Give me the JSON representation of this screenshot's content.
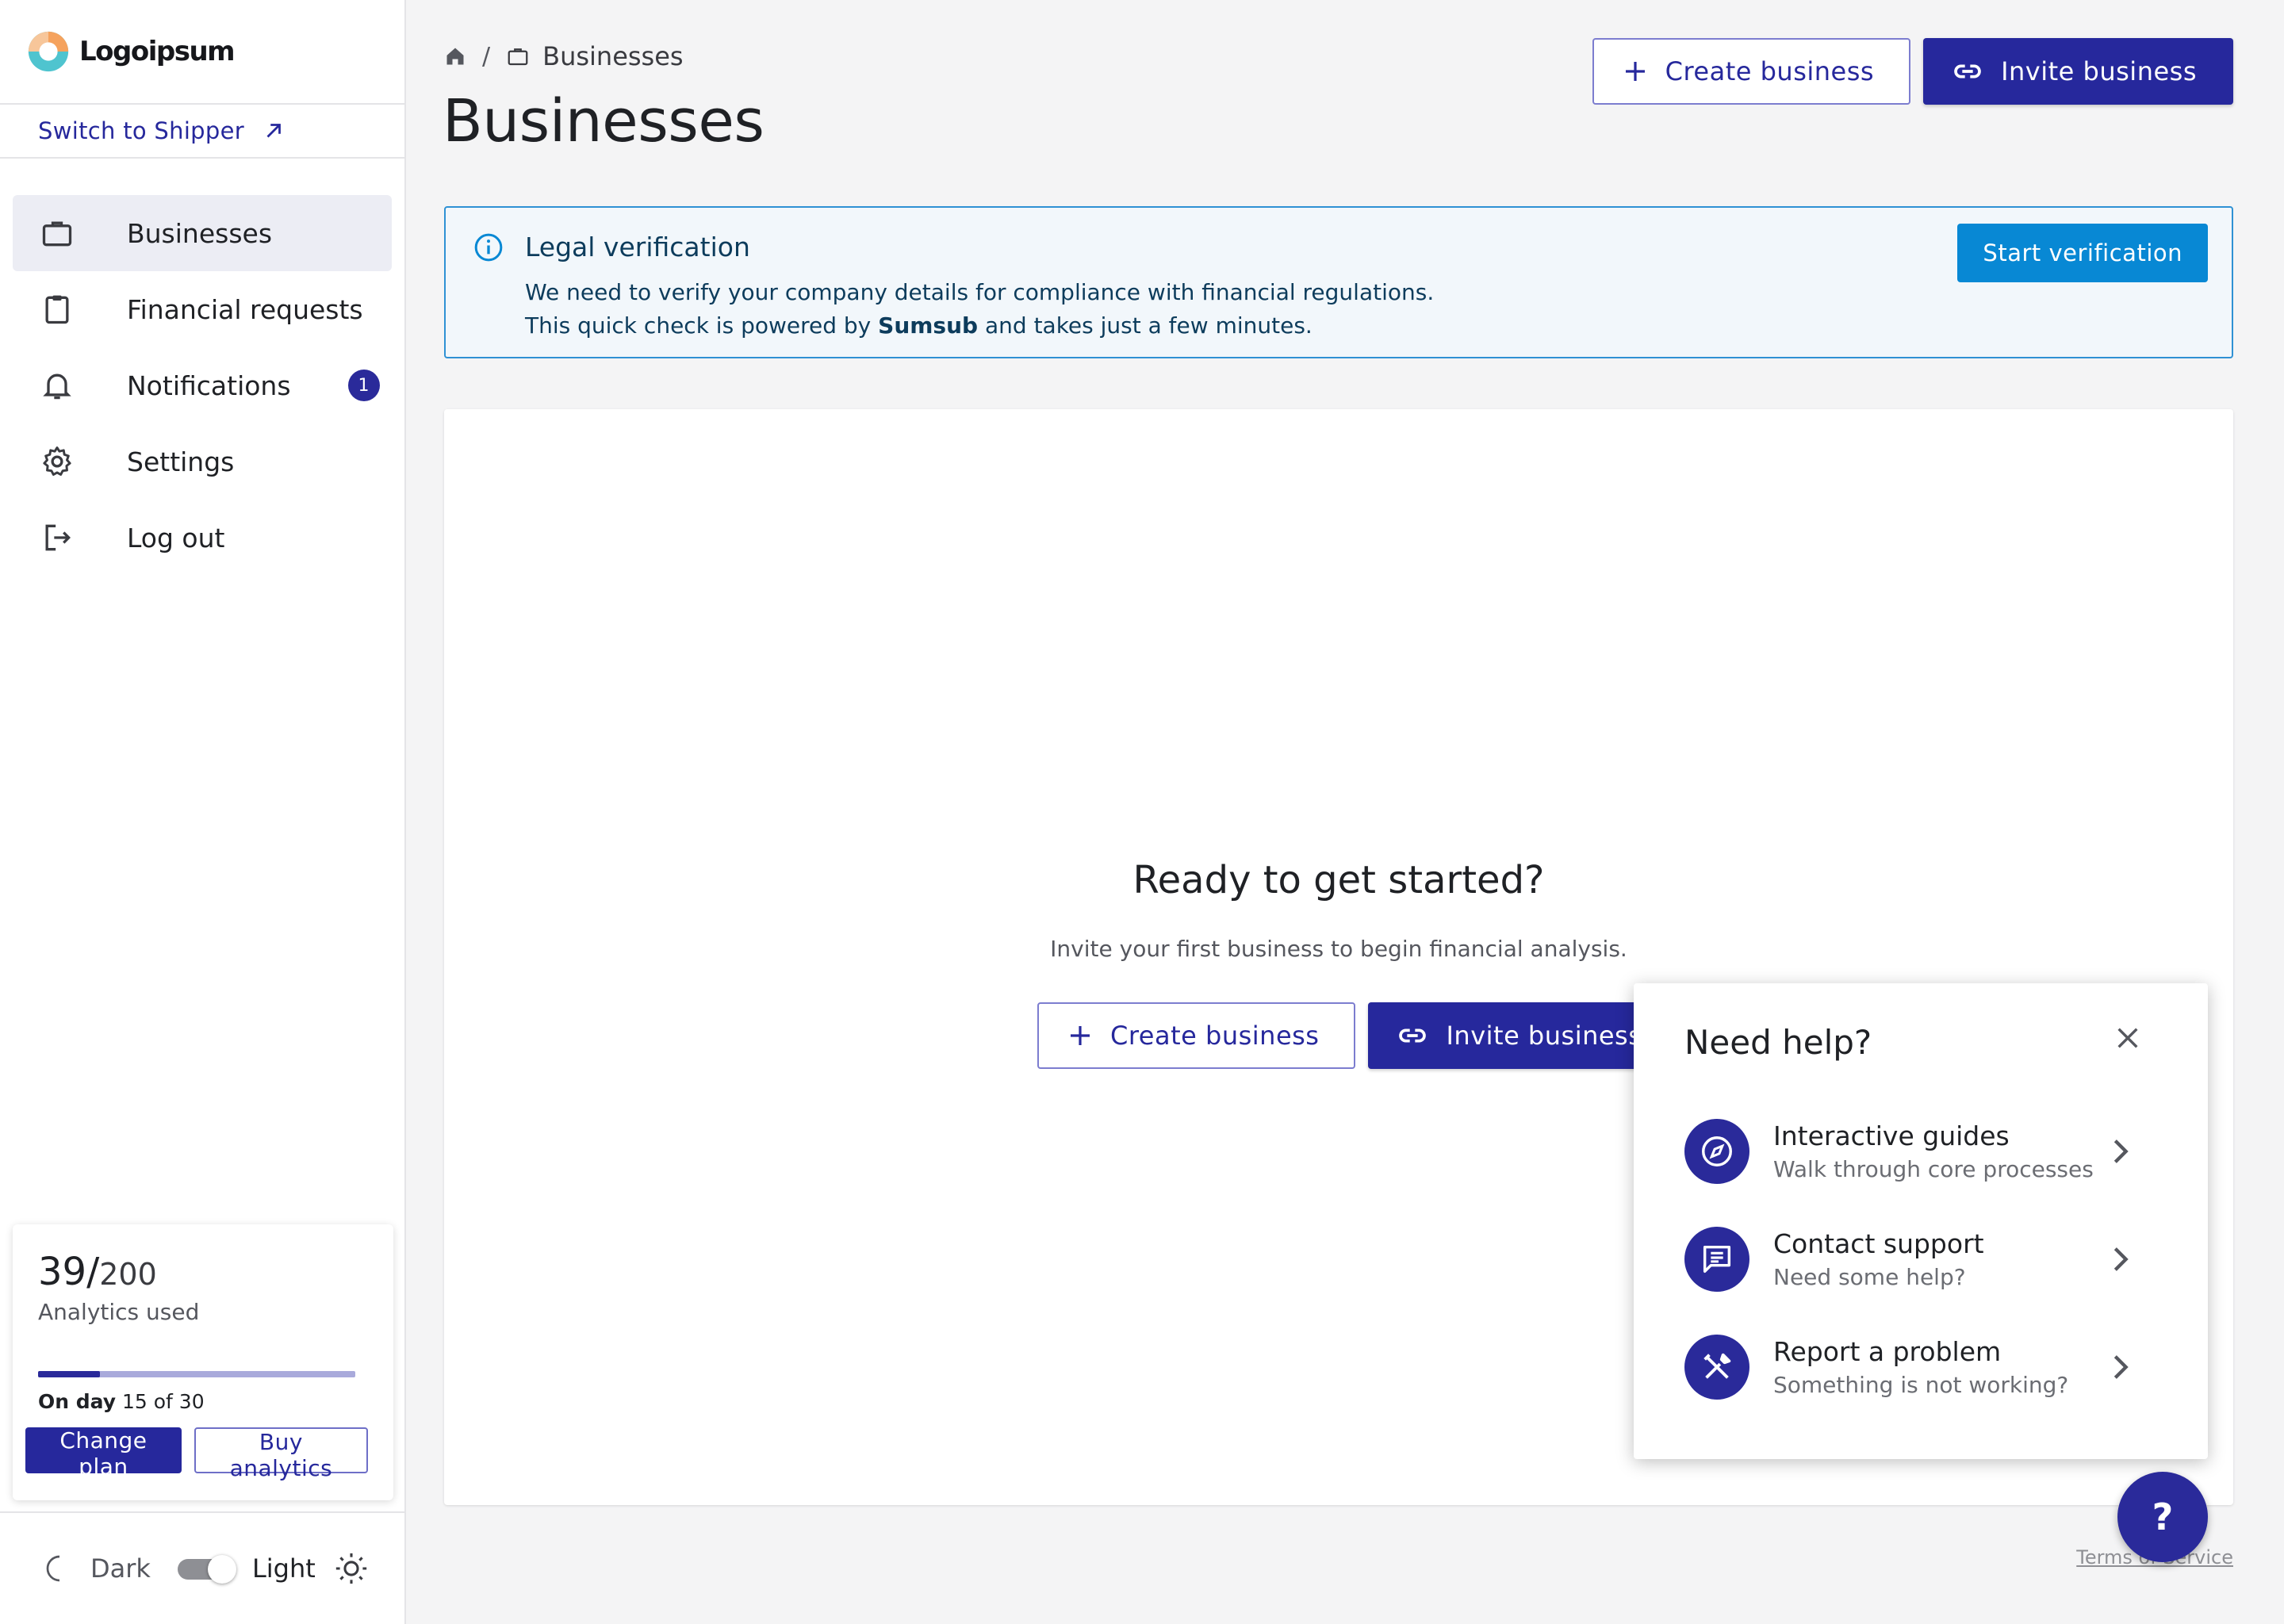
{
  "brand": {
    "logo_text": "Logoipsum",
    "colors": {
      "primary": "#26289c",
      "info": "#0888d4",
      "accent_orange": "#f5a25d",
      "accent_teal": "#4fc4cf"
    }
  },
  "sidebar": {
    "switch_link": "Switch to Shipper",
    "items": [
      {
        "label": "Businesses",
        "icon": "briefcase-icon",
        "active": true
      },
      {
        "label": "Financial requests",
        "icon": "clipboard-icon"
      },
      {
        "label": "Notifications",
        "icon": "bell-icon",
        "badge": "1"
      },
      {
        "label": "Settings",
        "icon": "gear-icon"
      },
      {
        "label": "Log out",
        "icon": "logout-icon"
      }
    ],
    "usage": {
      "used": "39/",
      "total": "200",
      "label": "Analytics used",
      "progress_fraction": 0.195,
      "day_prefix": "On day",
      "day_value": "15 of 30",
      "change_plan": "Change plan",
      "buy_analytics": "Buy analytics"
    },
    "theme": {
      "dark_label": "Dark",
      "light_label": "Light",
      "current": "light"
    }
  },
  "header": {
    "breadcrumb": {
      "current": "Businesses",
      "separator": "/"
    },
    "title": "Businesses",
    "create_button": "Create business",
    "invite_button": "Invite business"
  },
  "alert": {
    "title": "Legal verification",
    "line1": "We need to verify your company details for compliance with financial regulations.",
    "line2_prefix": "This quick check is powered by",
    "line2_brand": "Sumsub",
    "line2_suffix": "and takes just a few minutes.",
    "button": "Start verification"
  },
  "empty_state": {
    "title": "Ready to get started?",
    "subtitle": "Invite your first business to begin financial analysis.",
    "create_button": "Create business",
    "invite_button": "Invite business"
  },
  "help": {
    "title": "Need help?",
    "items": [
      {
        "title": "Interactive guides",
        "subtitle": "Walk through core processes",
        "icon": "compass-icon"
      },
      {
        "title": "Contact support",
        "subtitle": "Need some help?",
        "icon": "chat-icon"
      },
      {
        "title": "Report a problem",
        "subtitle": "Something is not working?",
        "icon": "tools-icon"
      }
    ],
    "fab_label": "?"
  },
  "footer": {
    "terms": "Terms of Service"
  }
}
